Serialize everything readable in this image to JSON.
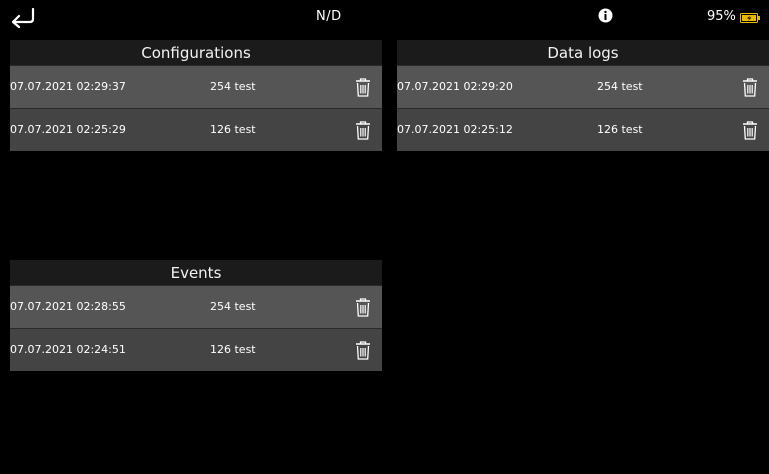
{
  "status_bar": {
    "back_icon": "back-arrow-icon",
    "center_text": "N/D",
    "info_icon": "info-icon",
    "battery_percent": "95%",
    "battery_icon": "battery-charging-icon",
    "battery_color": "#e6b800"
  },
  "configurations": {
    "title": "Configurations",
    "rows": [
      {
        "date": "07.07.2021 02:29:37",
        "name": "254 test"
      },
      {
        "date": "07.07.2021 02:25:29",
        "name": "126 test"
      }
    ]
  },
  "data_logs": {
    "title": "Data logs",
    "rows": [
      {
        "date": "07.07.2021 02:29:20",
        "name": "254 test"
      },
      {
        "date": "07.07.2021 02:25:12",
        "name": "126 test"
      }
    ]
  },
  "events": {
    "title": "Events",
    "rows": [
      {
        "date": "07.07.2021 02:28:55",
        "name": "254 test"
      },
      {
        "date": "07.07.2021 02:24:51",
        "name": "126 test"
      }
    ]
  },
  "row_action_icon": "trash-icon"
}
